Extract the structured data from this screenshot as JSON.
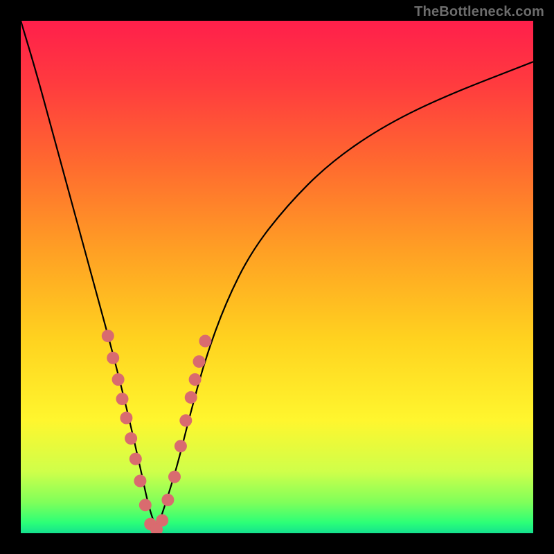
{
  "watermark": "TheBottleneck.com",
  "chart_data": {
    "type": "line",
    "title": "",
    "xlabel": "",
    "ylabel": "",
    "xlim": [
      0,
      100
    ],
    "ylim": [
      0,
      100
    ],
    "series": [
      {
        "name": "bottleneck-curve",
        "x": [
          0,
          3,
          6,
          9,
          12,
          15,
          18,
          21,
          23.5,
          25,
          26.5,
          28,
          30.5,
          33,
          36,
          40,
          45,
          52,
          60,
          70,
          82,
          100
        ],
        "y": [
          100,
          90,
          79,
          68,
          57,
          46,
          35,
          23,
          12,
          5,
          0.7,
          5,
          13,
          23,
          34,
          45,
          55,
          64,
          72,
          79,
          85,
          92
        ]
      }
    ],
    "dots": {
      "name": "highlight-dots",
      "x": [
        17.0,
        18.0,
        19.0,
        19.8,
        20.6,
        21.5,
        22.4,
        23.3,
        24.3,
        25.3,
        26.5,
        27.6,
        28.7,
        30.0,
        31.2,
        32.2,
        33.2,
        34.0,
        34.8,
        36.0
      ],
      "y": [
        38.5,
        34.2,
        30.0,
        26.2,
        22.5,
        18.5,
        14.5,
        10.2,
        5.5,
        1.8,
        0.7,
        2.5,
        6.5,
        11.0,
        17.0,
        22.0,
        26.5,
        30.0,
        33.5,
        37.5
      ]
    },
    "gradient_stops": [
      {
        "pos": 0.0,
        "color": "#ff1f4b"
      },
      {
        "pos": 0.5,
        "color": "#ffd21f"
      },
      {
        "pos": 0.95,
        "color": "#7fff5a"
      },
      {
        "pos": 1.0,
        "color": "#14e08e"
      }
    ]
  }
}
